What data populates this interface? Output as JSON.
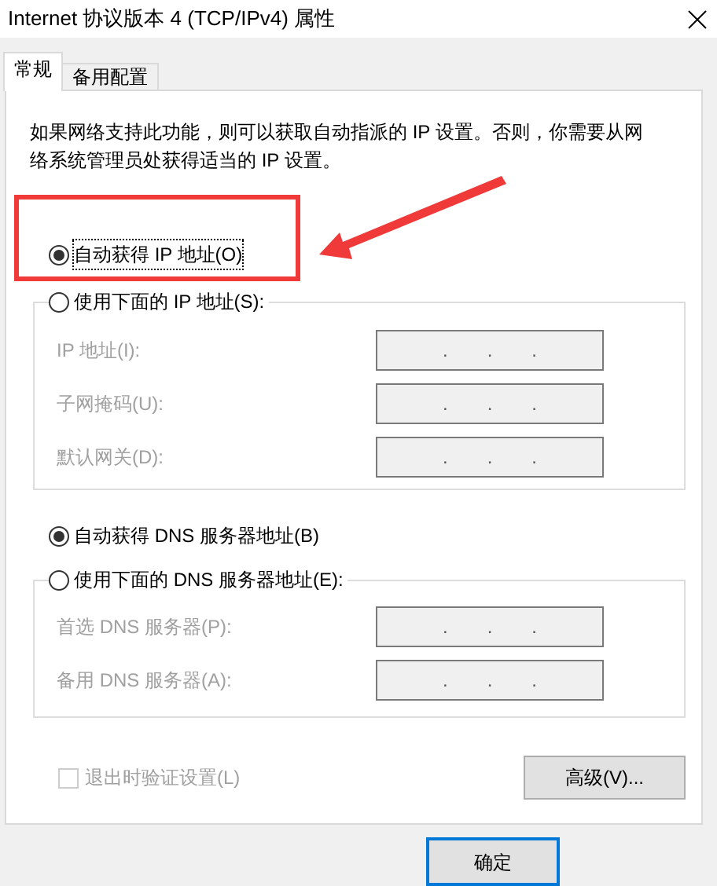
{
  "window": {
    "title": "Internet 协议版本 4 (TCP/IPv4) 属性"
  },
  "tabs": [
    {
      "label": "常规",
      "selected": true
    },
    {
      "label": "备用配置",
      "selected": false
    }
  ],
  "description": "如果网络支持此功能，则可以获取自动指派的 IP 设置。否则，你需要从网络系统管理员处获得适当的 IP 设置。",
  "sections": [
    {
      "auto_option": {
        "label": "自动获得 IP 地址(O)",
        "selected": true,
        "focused": true
      },
      "manual_option": {
        "label": "使用下面的 IP 地址(S):",
        "selected": false
      },
      "fields_disabled": true,
      "fields": [
        {
          "label": "IP 地址(I):",
          "separators": [
            ".",
            ".",
            "."
          ]
        },
        {
          "label": "子网掩码(U):",
          "separators": [
            ".",
            ".",
            "."
          ]
        },
        {
          "label": "默认网关(D):",
          "separators": [
            ".",
            ".",
            "."
          ]
        }
      ]
    },
    {
      "auto_option": {
        "label": "自动获得 DNS 服务器地址(B)",
        "selected": true,
        "focused": false
      },
      "manual_option": {
        "label": "使用下面的 DNS 服务器地址(E):",
        "selected": false
      },
      "fields_disabled": true,
      "fields": [
        {
          "label": "首选 DNS 服务器(P):",
          "separators": [
            ".",
            ".",
            "."
          ]
        },
        {
          "label": "备用 DNS 服务器(A):",
          "separators": [
            ".",
            ".",
            "."
          ]
        }
      ]
    }
  ],
  "validate_checkbox": {
    "label": "退出时验证设置(L)",
    "checked": false,
    "disabled": true
  },
  "advanced_button": "高级(V)...",
  "buttons": [
    {
      "label": "确定",
      "default": true
    }
  ]
}
